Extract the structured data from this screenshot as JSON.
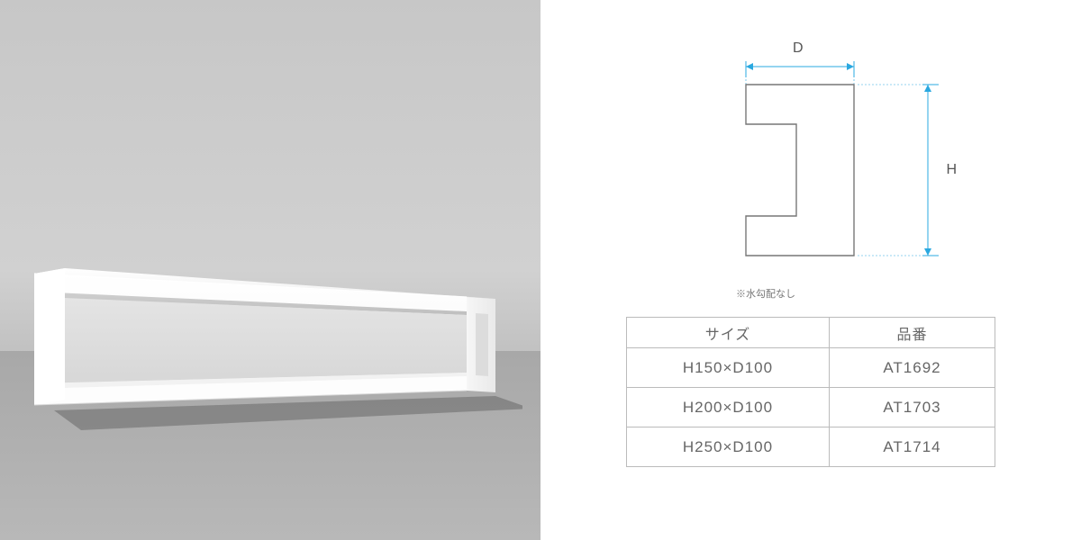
{
  "diagram": {
    "label_d": "D",
    "label_h": "H",
    "note": "※水勾配なし"
  },
  "table": {
    "headers": {
      "size": "サイズ",
      "code": "品番"
    },
    "rows": [
      {
        "size": "H150×D100",
        "code": "AT1692"
      },
      {
        "size": "H200×D100",
        "code": "AT1703"
      },
      {
        "size": "H250×D100",
        "code": "AT1714"
      }
    ]
  }
}
